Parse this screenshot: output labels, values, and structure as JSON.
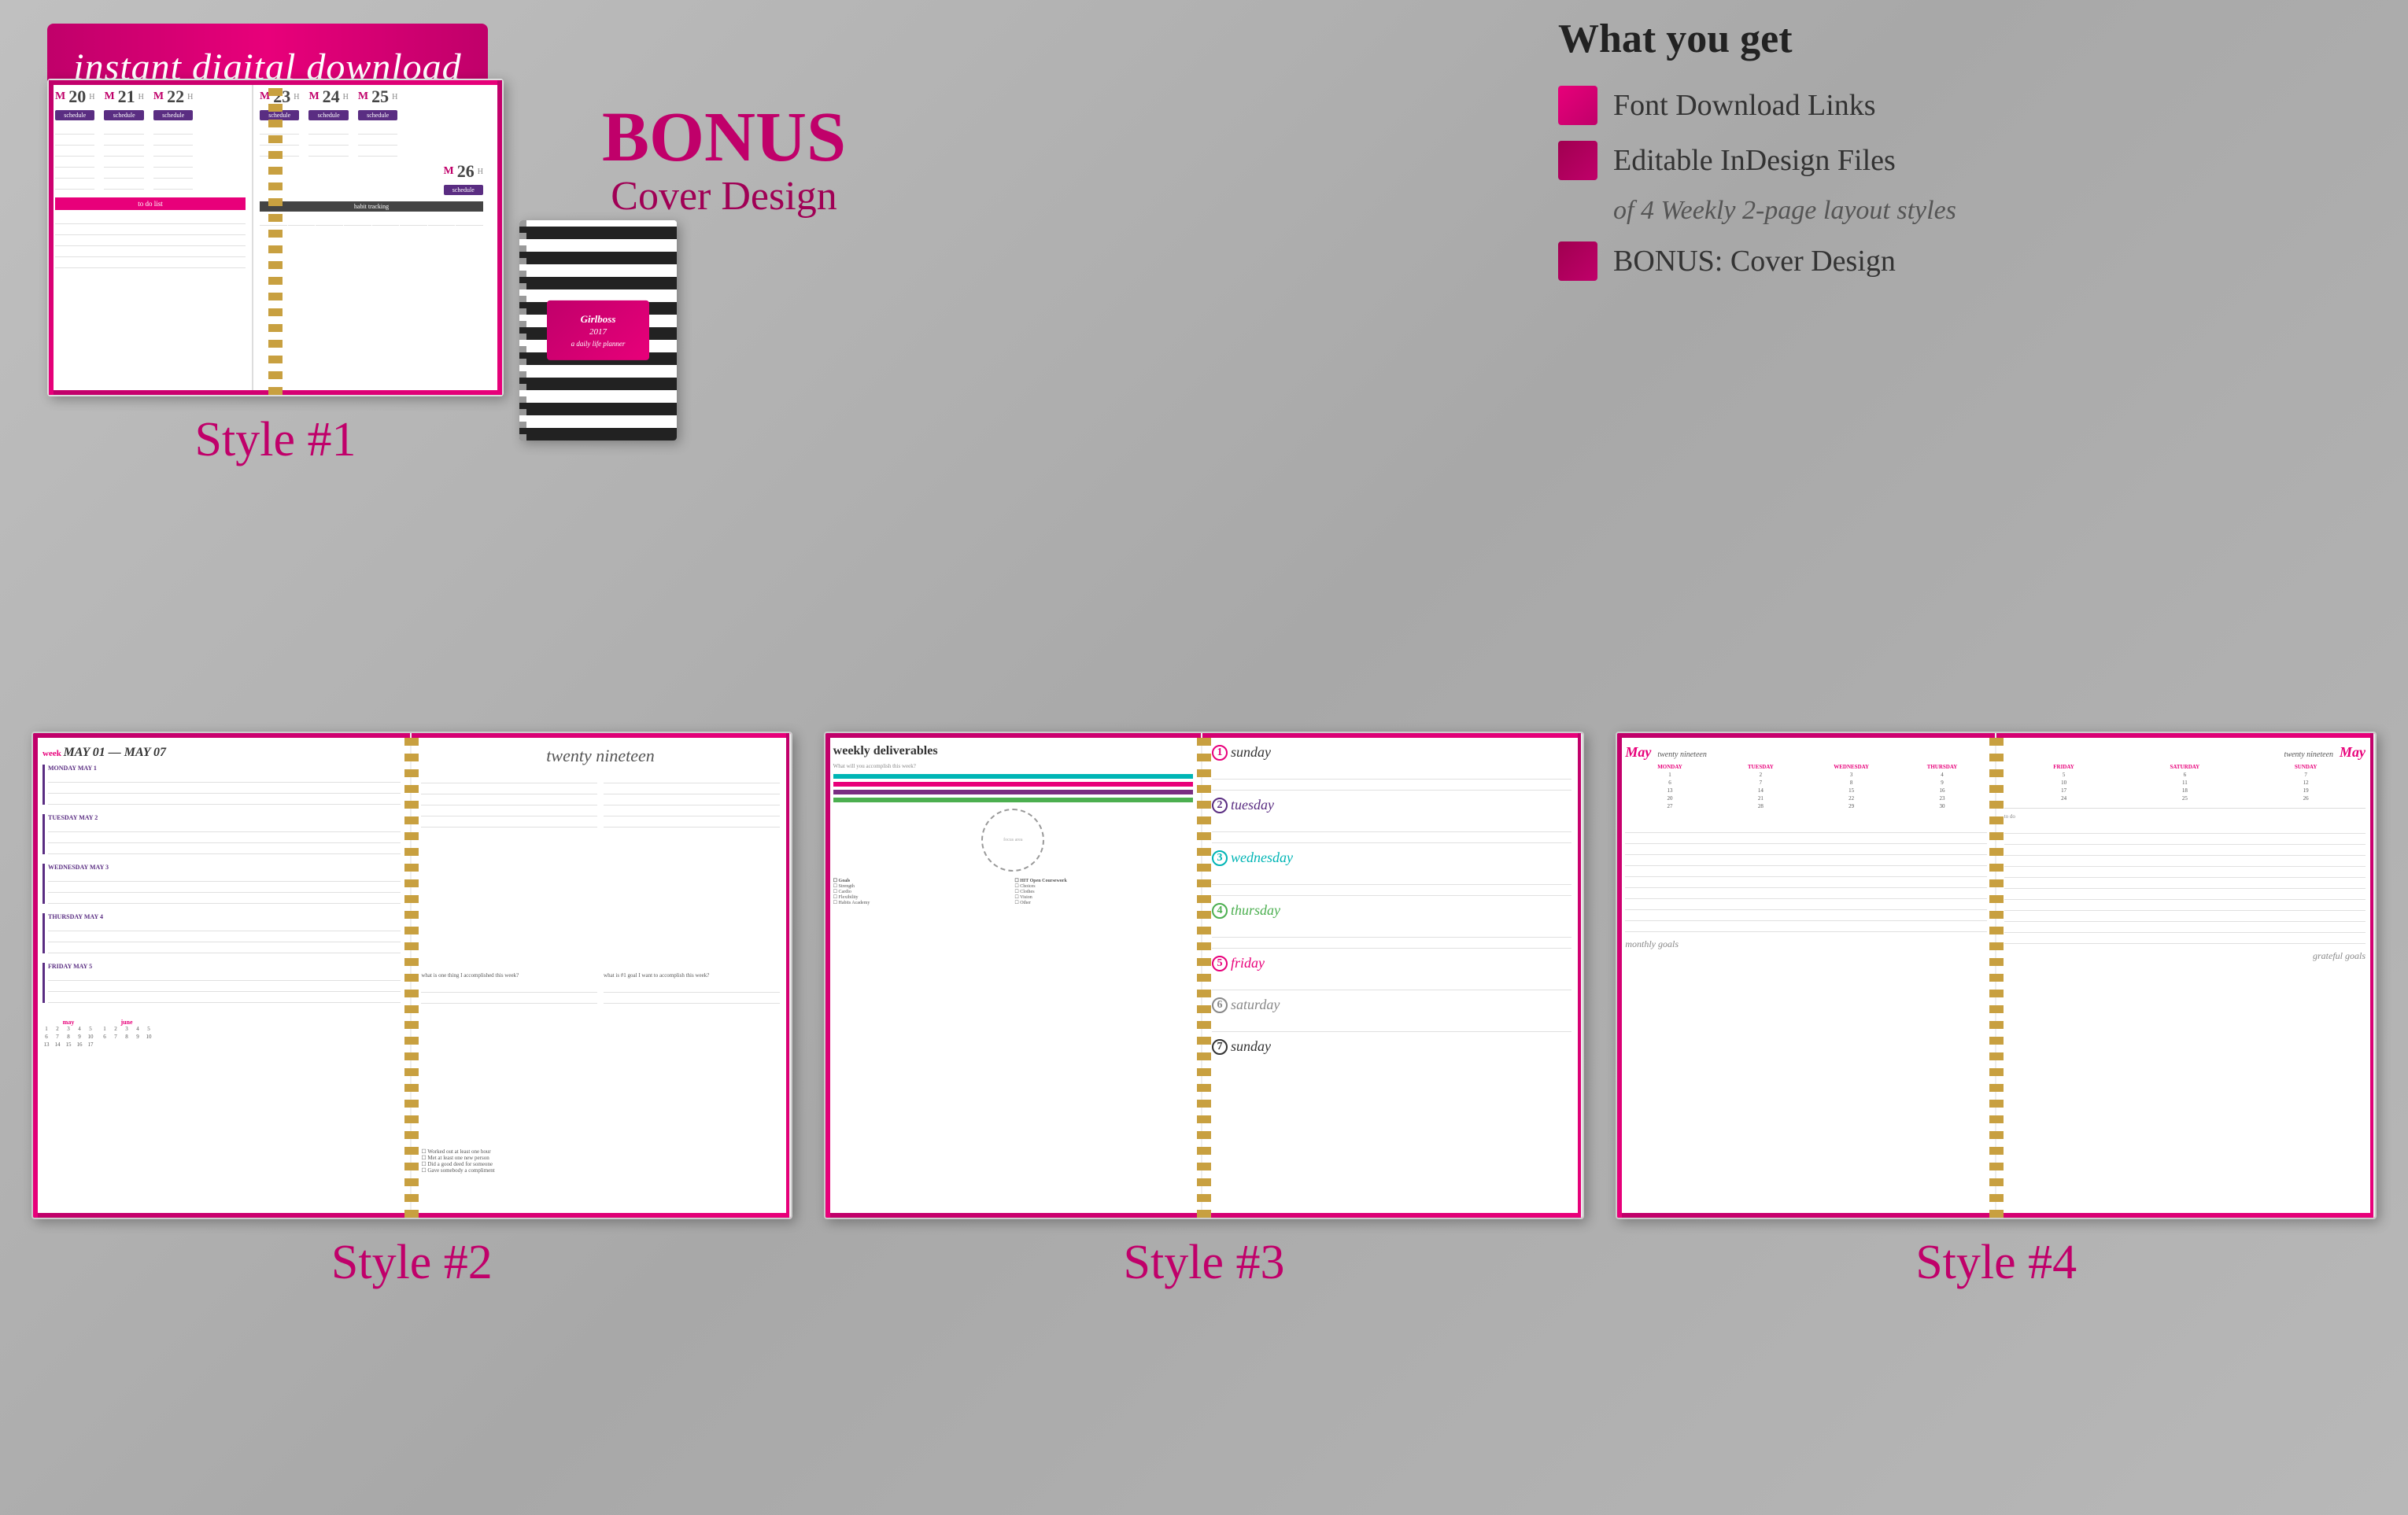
{
  "banner": {
    "text": "instant digital download"
  },
  "what_you_get": {
    "title": "What you get",
    "features": [
      {
        "text": "Font Download Links",
        "icon_style": "light"
      },
      {
        "text": "Editable InDesign Files",
        "icon_style": "dark"
      },
      {
        "subtext": "of 4 Weekly 2-page layout styles"
      },
      {
        "text": "BONUS: Cover Design",
        "icon_style": "dark"
      }
    ]
  },
  "bonus": {
    "title": "BONUS",
    "subtitle": "Cover Design",
    "cover": {
      "brand": "Girlboss",
      "year": "2017"
    }
  },
  "styles": [
    {
      "label": "Style #1"
    },
    {
      "label": "Style #2"
    },
    {
      "label": "Style #3"
    },
    {
      "label": "Style #4"
    }
  ],
  "planner_days": [
    "M20",
    "M21",
    "M22",
    "M23",
    "M24",
    "M25"
  ],
  "schedule_label": "schedule",
  "todo_label": "to do list",
  "habit_label": "habit tracking",
  "days_of_week": [
    "monday",
    "tuesday",
    "wednesday",
    "thursday",
    "friday"
  ],
  "months": [
    "May"
  ],
  "calendar_months": [
    "may",
    "june"
  ]
}
